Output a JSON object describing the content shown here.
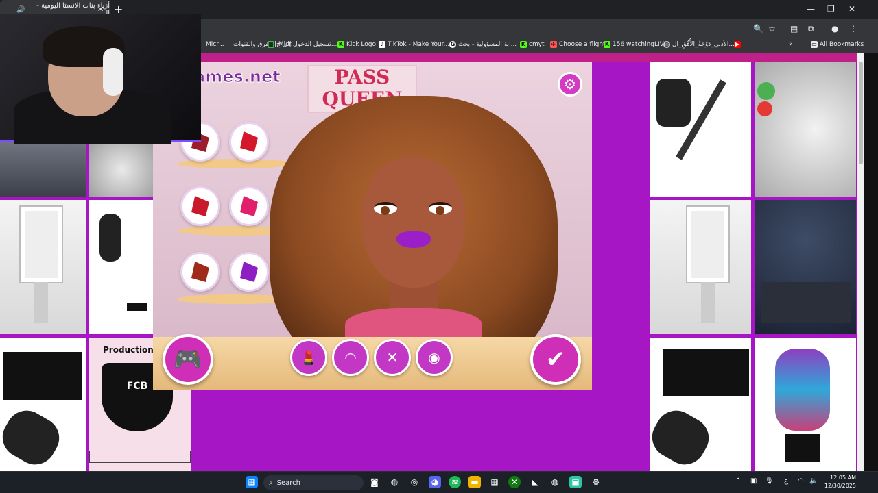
{
  "browser": {
    "tab_title": "أزياء بنات الانستا اليومية - ال",
    "new_tab": "+",
    "window_controls": {
      "minimize": "—",
      "restore": "❐",
      "close": "✕"
    }
  },
  "bookmarks": [
    {
      "label": "Micr...",
      "icon": "folder-icon"
    },
    {
      "label": "الفرق والقنوات | Micr...",
      "icon": "teams-icon"
    },
    {
      "label": "تسجيل الدخول إلى ح...",
      "icon": "windows-icon"
    },
    {
      "label": "Kick Logo",
      "icon": "kick-icon"
    },
    {
      "label": "TikTok - Make Your...",
      "icon": "tiktok-icon"
    },
    {
      "label": "ابة المسؤولية - بحث...",
      "icon": "google-icon"
    },
    {
      "label": "cmyt",
      "icon": "kick-icon"
    },
    {
      "label": "Choose a flight",
      "icon": "plane-icon"
    },
    {
      "label": "156 watchingLIVE",
      "icon": "kick-icon"
    },
    {
      "label": "الأدبي_دَوْحَةُ_الأُفُقِ_ال...",
      "icon": "globe-icon"
    },
    {
      "label": "All Bookmarks",
      "icon": "folder-icon"
    }
  ],
  "game": {
    "logo": "ames.net",
    "poster": "PASS\nQUEEN",
    "lipstick_swatches": [
      {
        "color": "#9c1e2a"
      },
      {
        "color": "#d4182c"
      },
      {
        "color": "#c81a2a"
      },
      {
        "color": "#e0206a"
      },
      {
        "color": "#a12b1a"
      },
      {
        "color": "#8d1ec2"
      }
    ],
    "tools": [
      "lipstick-icon",
      "eyebrow-icon",
      "brush-icon",
      "perfume-icon"
    ],
    "confirm": "✔",
    "gamepad": "🎮",
    "settings": "⚙"
  },
  "ads": {
    "production_title": "Production :",
    "crest_text": "FCB"
  },
  "taskbar": {
    "search": "Search",
    "time": "12:05 AM",
    "date": "12/30/2025",
    "lang": "ع"
  }
}
